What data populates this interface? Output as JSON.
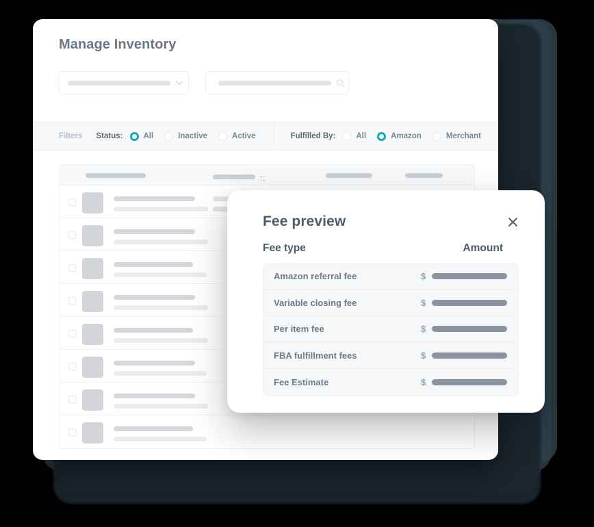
{
  "background": {
    "canvas_color": "#000000",
    "stack_color": "#24333d"
  },
  "card": {
    "title": "Manage Inventory",
    "accent_color": "#18a7b5",
    "title_color": "#6b7785",
    "background": "#ffffff"
  },
  "controls": {
    "category_select": {
      "name": "category-select",
      "value": "",
      "placeholder": "",
      "icon": "chevron-down-icon"
    },
    "search": {
      "name": "search-input",
      "value": "",
      "placeholder": "",
      "icon": "search-icon"
    }
  },
  "filters": {
    "label": "Filters",
    "groups": [
      {
        "label": "Status:",
        "name": "status",
        "options": [
          {
            "label": "All",
            "selected": true
          },
          {
            "label": "Inactive",
            "selected": false
          },
          {
            "label": "Active",
            "selected": false
          }
        ]
      },
      {
        "label": "Fulfilled By:",
        "name": "fulfilled-by",
        "options": [
          {
            "label": "All",
            "selected": false
          },
          {
            "label": "Amazon",
            "selected": true
          },
          {
            "label": "Merchant",
            "selected": false
          }
        ]
      }
    ]
  },
  "table": {
    "header": {
      "columns": [
        {
          "name": "product-column",
          "placeholder_width": 88,
          "sortable": false
        },
        {
          "name": "details-column",
          "placeholder_width": 62,
          "sortable": true,
          "sort_icon": "sort-icon"
        },
        {
          "name": "price-column",
          "placeholder_width": 68,
          "sortable": false
        },
        {
          "name": "status-column",
          "placeholder_width": 55,
          "sortable": false
        }
      ]
    },
    "rows": [
      {
        "name": "table-row",
        "has_price_cell": true,
        "has_col2": true,
        "has_col4": true,
        "line1": 119,
        "line2": 138
      },
      {
        "name": "table-row",
        "has_price_cell": false,
        "has_col2": false,
        "has_col4": false,
        "line1": 119,
        "line2": 138
      },
      {
        "name": "table-row",
        "has_price_cell": false,
        "has_col2": false,
        "has_col4": false,
        "line1": 116,
        "line2": 136
      },
      {
        "name": "table-row",
        "has_price_cell": false,
        "has_col2": false,
        "has_col4": false,
        "line1": 119,
        "line2": 138
      },
      {
        "name": "table-row",
        "has_price_cell": false,
        "has_col2": false,
        "has_col4": false,
        "line1": 116,
        "line2": 138
      },
      {
        "name": "table-row",
        "has_price_cell": false,
        "has_col2": false,
        "has_col4": false,
        "line1": 119,
        "line2": 136
      },
      {
        "name": "table-row",
        "has_price_cell": false,
        "has_col2": false,
        "has_col4": false,
        "line1": 119,
        "line2": 138
      },
      {
        "name": "table-row",
        "has_price_cell": false,
        "has_col2": false,
        "has_col4": false,
        "line1": 116,
        "line2": 136
      }
    ],
    "price_prefix": "$"
  },
  "modal": {
    "title": "Fee preview",
    "close_icon": "close-icon",
    "columns": {
      "fee_type": "Fee type",
      "amount": "Amount"
    },
    "currency_symbol": "$",
    "rows": [
      {
        "fee_type": "Amazon referral fee",
        "amount": ""
      },
      {
        "fee_type": "Variable closing fee",
        "amount": ""
      },
      {
        "fee_type": "Per item fee",
        "amount": ""
      },
      {
        "fee_type": "FBA fulfillment fees",
        "amount": ""
      },
      {
        "fee_type": "Fee Estimate",
        "amount": ""
      }
    ]
  }
}
